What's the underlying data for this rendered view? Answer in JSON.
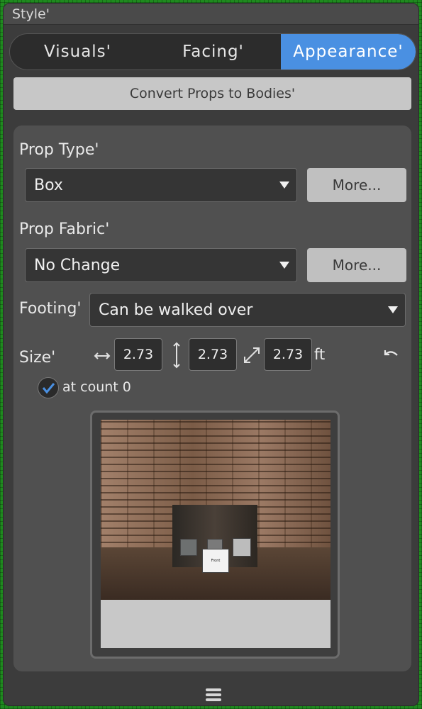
{
  "window": {
    "title": "Style'"
  },
  "tabs": [
    {
      "label": "Visuals'",
      "active": false
    },
    {
      "label": "Facing'",
      "active": false
    },
    {
      "label": "Appearance'",
      "active": true
    }
  ],
  "convert_button": {
    "label": "Convert Props to Bodies'"
  },
  "prop_type": {
    "label": "Prop Type'",
    "value": "Box",
    "more_label": "More..."
  },
  "prop_fabric": {
    "label": "Prop Fabric'",
    "value": "No Change",
    "more_label": "More..."
  },
  "footing": {
    "label": "Footing'",
    "value": "Can be walked over"
  },
  "size": {
    "label": "Size'",
    "width": "2.73",
    "height": "2.73",
    "depth": "2.73",
    "unit": "ft",
    "at_count_label": "at count 0",
    "at_count_checked": true
  },
  "preview": {
    "front_cube_label": "Front"
  },
  "colors": {
    "accent": "#4a90e2",
    "panel": "#505050",
    "button": "#c7c7c7"
  },
  "icons": {
    "width": "horizontal-arrow-icon",
    "height": "vertical-arrow-icon",
    "depth": "diagonal-arrow-icon",
    "reset": "undo-icon",
    "checkbox": "checkmark-icon",
    "grip": "drag-handle-icon"
  }
}
